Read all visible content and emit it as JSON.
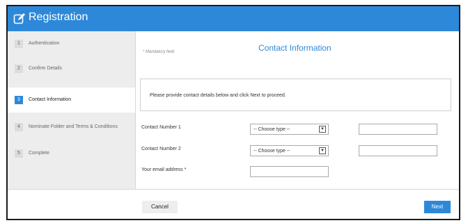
{
  "header": {
    "title": "Registration",
    "icon": "edit-icon",
    "color": "#2e88d9"
  },
  "sidebar": {
    "steps": [
      {
        "num": "1",
        "label": "Authentication"
      },
      {
        "num": "2",
        "label": "Confirm Details"
      },
      {
        "num": "3",
        "label": "Contact Information",
        "active": true
      },
      {
        "num": "4",
        "label": "Nominate Folder and Terms & Conditions"
      },
      {
        "num": "5",
        "label": "Complete"
      }
    ]
  },
  "main": {
    "mandatory_note": "* Mandatory field",
    "section_title": "Contact Information",
    "info_text": "Please provide contact details below and click Next to proceed.",
    "fields": {
      "contact1_label": "Contact Number 1",
      "contact1_type": "-- Choose type --",
      "contact2_label": "Contact Number 2",
      "contact2_type": "-- Choose type --",
      "email_label": "Your email address *"
    }
  },
  "footer": {
    "cancel_label": "Cancel",
    "next_label": "Next"
  }
}
